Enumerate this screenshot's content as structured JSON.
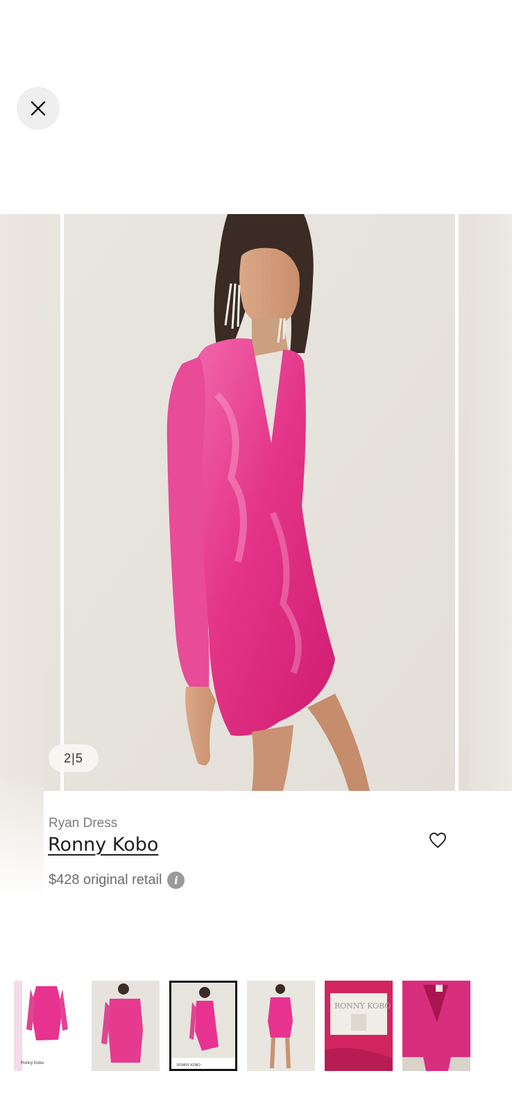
{
  "viewer": {
    "close_icon": "close-icon",
    "image_counter": "2|5"
  },
  "product": {
    "name": "Ryan Dress",
    "designer": "Ronny Kobo",
    "price_text": "$428 original retail",
    "info_icon_glyph": "i",
    "favorite_icon": "heart-outline-icon"
  },
  "thumbnails": {
    "selected_index": 2,
    "count": 6,
    "label_brand": "RONNY KOBO"
  },
  "colors": {
    "dress_pink": "#e8328f",
    "background_neutral": "#e7e4dd",
    "thumbnail_selected_border": "#111111"
  }
}
